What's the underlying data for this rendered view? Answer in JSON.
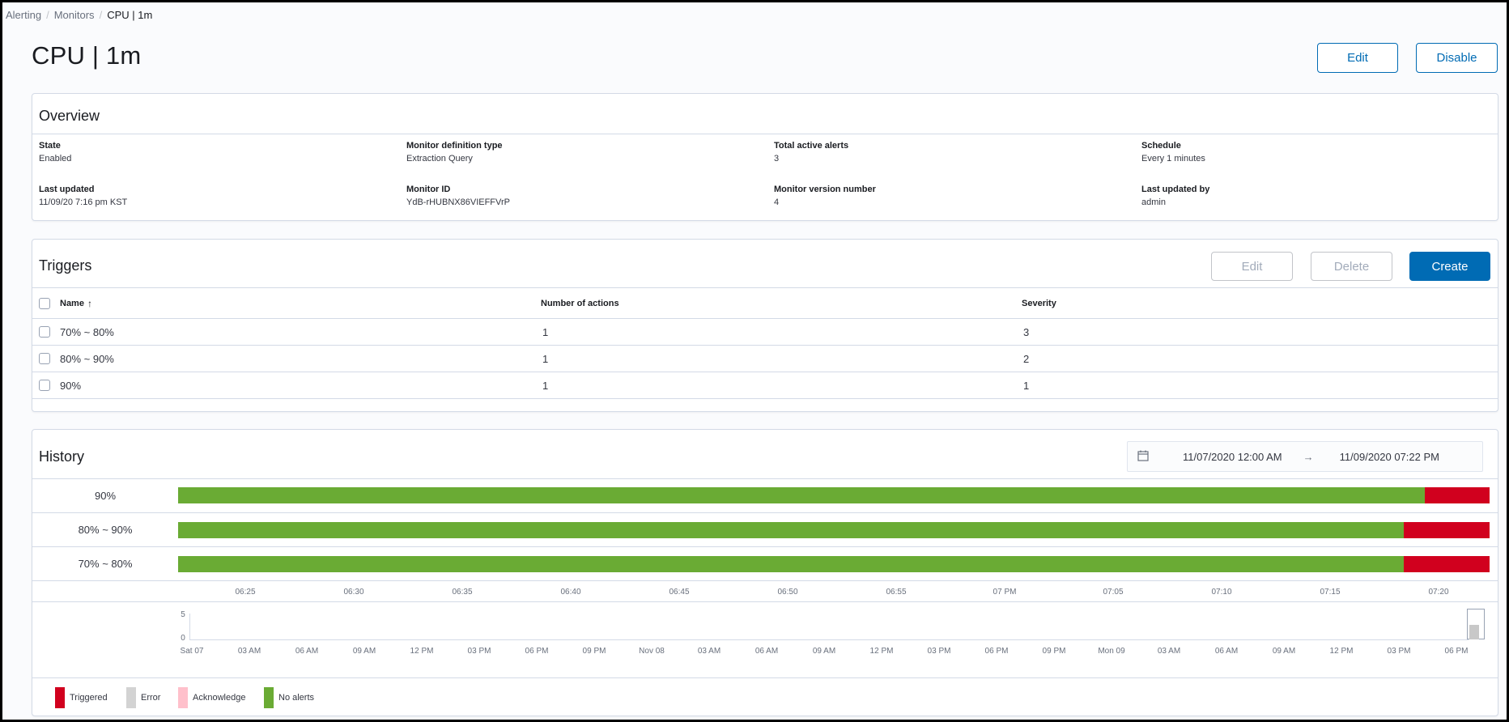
{
  "breadcrumb": {
    "items": [
      "Alerting",
      "Monitors",
      "CPU | 1m"
    ]
  },
  "page": {
    "title": "CPU | 1m",
    "edit_label": "Edit",
    "disable_label": "Disable"
  },
  "overview": {
    "title": "Overview",
    "fields": [
      {
        "label": "State",
        "value": "Enabled"
      },
      {
        "label": "Monitor definition type",
        "value": "Extraction Query"
      },
      {
        "label": "Total active alerts",
        "value": "3"
      },
      {
        "label": "Schedule",
        "value": "Every 1 minutes"
      },
      {
        "label": "Last updated",
        "value": "11/09/20 7:16 pm KST"
      },
      {
        "label": "Monitor ID",
        "value": "YdB-rHUBNX86VIEFFVrP"
      },
      {
        "label": "Monitor version number",
        "value": "4"
      },
      {
        "label": "Last updated by",
        "value": "admin"
      }
    ]
  },
  "triggers": {
    "title": "Triggers",
    "edit_label": "Edit",
    "delete_label": "Delete",
    "create_label": "Create",
    "columns": [
      "Name",
      "Number of actions",
      "Severity"
    ],
    "sort_icon": "arrow-up-icon",
    "rows": [
      {
        "name": "70% ~ 80%",
        "actions": "1",
        "severity": "3"
      },
      {
        "name": "80% ~ 90%",
        "actions": "1",
        "severity": "2"
      },
      {
        "name": "90%",
        "actions": "1",
        "severity": "1"
      }
    ]
  },
  "history": {
    "title": "History",
    "date_start": "11/07/2020 12:00 AM",
    "date_arrow": "→",
    "date_end": "11/09/2020 07:22 PM",
    "rows": [
      {
        "label": "90%",
        "triggered_fraction": 0.05
      },
      {
        "label": "80% ~ 90%",
        "triggered_fraction": 0.066
      },
      {
        "label": "70% ~ 80%",
        "triggered_fraction": 0.066
      }
    ],
    "time_ticks": [
      "06:25",
      "06:30",
      "06:35",
      "06:40",
      "06:45",
      "06:50",
      "06:55",
      "07 PM",
      "07:05",
      "07:10",
      "07:15",
      "07:20"
    ],
    "overview_y_ticks": [
      "5",
      "0"
    ],
    "overview_x_ticks": [
      "Sat 07",
      "03 AM",
      "06 AM",
      "09 AM",
      "12 PM",
      "03 PM",
      "06 PM",
      "09 PM",
      "Nov 08",
      "03 AM",
      "06 AM",
      "09 AM",
      "12 PM",
      "03 PM",
      "06 PM",
      "09 PM",
      "Mon 09",
      "03 AM",
      "06 AM",
      "09 AM",
      "12 PM",
      "03 PM",
      "06 PM"
    ],
    "legend": [
      {
        "label": "Triggered",
        "color": "#d1001e"
      },
      {
        "label": "Error",
        "color": "#d3d3d3"
      },
      {
        "label": "Acknowledge",
        "color": "#ffc0cb"
      },
      {
        "label": "No alerts",
        "color": "#6aab34"
      }
    ]
  }
}
